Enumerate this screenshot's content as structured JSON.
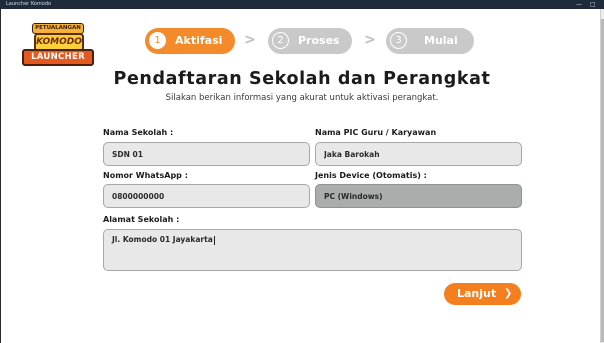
{
  "window": {
    "title": "Launcher Komodo",
    "controls": {
      "minimize": "—",
      "restore": "□"
    }
  },
  "logo": {
    "line1": "PETUALANGAN",
    "line2": "KOMODO",
    "line3": "LAUNCHER"
  },
  "stepper": {
    "steps": [
      {
        "number": "1",
        "label": "Aktifasi",
        "state": "active"
      },
      {
        "number": "2",
        "label": "Proses",
        "state": "inactive"
      },
      {
        "number": "3",
        "label": "Mulai",
        "state": "inactive"
      }
    ],
    "separator": ">"
  },
  "page": {
    "title": "Pendaftaran Sekolah dan Perangkat",
    "subtitle": "Silakan berikan informasi yang akurat untuk aktivasi perangkat."
  },
  "form": {
    "school_name": {
      "label": "Nama Sekolah :",
      "value": "SDN 01"
    },
    "pic_name": {
      "label": "Nama PIC Guru / Karyawan",
      "value": "Jaka Barokah"
    },
    "whatsapp": {
      "label": "Nomor WhatsApp :",
      "value": "0800000000"
    },
    "device_type": {
      "label": "Jenis Device (Otomatis) :",
      "value": "PC (Windows)"
    },
    "address": {
      "label": "Alamat Sekolah :",
      "value": "Jl. Komodo 01 Jayakarta"
    }
  },
  "actions": {
    "next_label": "Lanjut",
    "next_icon": "chevron-right-icon"
  },
  "colors": {
    "accent": "#f38b2a",
    "inactive_step": "#c9c9c9",
    "readonly_field": "#a9adab"
  }
}
